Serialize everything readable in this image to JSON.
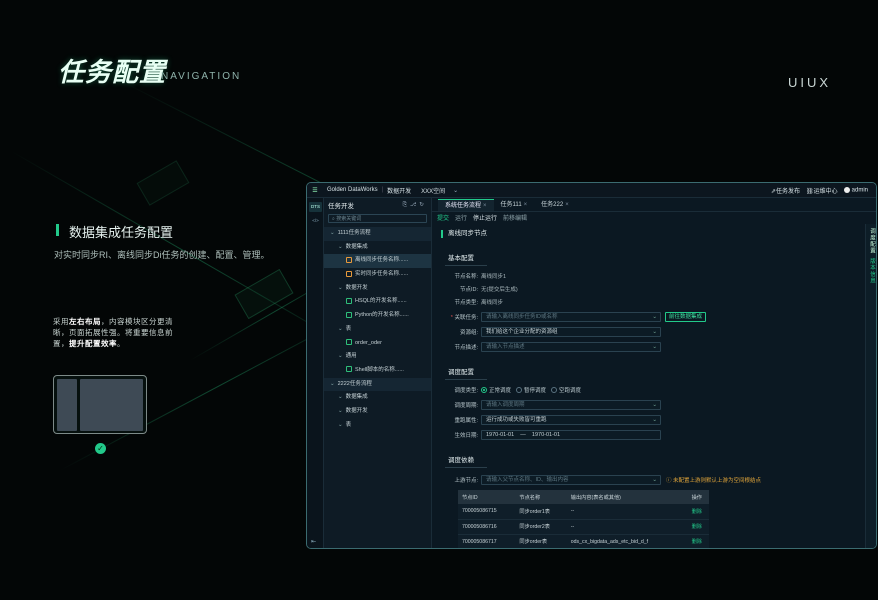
{
  "page": {
    "title": "任务配置",
    "nav_label": "NAVIGATION",
    "brand_tag": "UIUX",
    "section_title": "数据集成任务配置",
    "section_desc": "对实时同步RI、离线同步Di任务的创建、配置、管理。",
    "note_prefix": "采用",
    "note_bold1": "左右布局",
    "note_mid": "，内容模块区分更清晰，页面拓展性强。将重要信息前置，",
    "note_bold2": "提升配置效率",
    "note_suffix": "。",
    "accent": "#22c98a"
  },
  "app": {
    "topbar": {
      "menu_icon": "☰",
      "brand": "Golden DataWorks",
      "module": "数据开发",
      "space": "XXX空间",
      "right_items": [
        "任务发布",
        "运维中心"
      ],
      "user": "admin"
    },
    "rail": {
      "items": [
        "DTS",
        "</>"
      ]
    },
    "sidebar": {
      "title": "任务开发",
      "search_placeholder": "搜索关键词",
      "tree": [
        {
          "label": "1111任务流程",
          "level": 0,
          "type": "root"
        },
        {
          "label": "数据集成",
          "level": 1,
          "type": "folder"
        },
        {
          "label": "离线同步任务名称......",
          "level": 2,
          "type": "file-orange",
          "selected": true
        },
        {
          "label": "实时同步任务名称......",
          "level": 2,
          "type": "file-orange"
        },
        {
          "label": "数据开发",
          "level": 1,
          "type": "folder"
        },
        {
          "label": "HSQL的开发名称......",
          "level": 2,
          "type": "file-green"
        },
        {
          "label": "Python的开发名称......",
          "level": 2,
          "type": "file-green"
        },
        {
          "label": "表",
          "level": 1,
          "type": "folder"
        },
        {
          "label": "order_oder",
          "level": 2,
          "type": "file-green"
        },
        {
          "label": "通用",
          "level": 1,
          "type": "folder"
        },
        {
          "label": "Shell脚本的名称......",
          "level": 2,
          "type": "file-green"
        },
        {
          "label": "2222任务流程",
          "level": 0,
          "type": "root"
        },
        {
          "label": "数据集成",
          "level": 1,
          "type": "folder"
        },
        {
          "label": "数据开发",
          "level": 1,
          "type": "folder"
        },
        {
          "label": "表",
          "level": 1,
          "type": "folder"
        }
      ]
    },
    "tabs": [
      {
        "label": "系统任务流程",
        "active": true
      },
      {
        "label": "任务111",
        "active": false
      },
      {
        "label": "任务222",
        "active": false
      }
    ],
    "toolbar": [
      "提交",
      "运行",
      "停止运行",
      "前移编辑"
    ],
    "side_tabs": [
      "调度配置",
      "版本信息"
    ],
    "node_title": "离线同步节点",
    "basic": {
      "heading": "基本配置",
      "name_label": "节点名称:",
      "name_value": "离线同步1",
      "id_label": "节点ID:",
      "id_value": "无(提交后生成)",
      "type_label": "节点类型:",
      "type_value": "离线同步",
      "link_label": "关联任务:",
      "link_placeholder": "请输入离线同步任务ID或名称",
      "link_button": "前往数据集成",
      "group_label": "资源组:",
      "group_value": "我们给这个企业分配的资源组",
      "desc_label": "节点描述:",
      "desc_placeholder": "请输入节点描述"
    },
    "schedule": {
      "heading": "调度配置",
      "type_label": "调度类型:",
      "types": [
        "正常调度",
        "暂停调度",
        "空跑调度"
      ],
      "period_label": "调度周期:",
      "period_placeholder": "请输入调度周期",
      "rerun_label": "重跑属性:",
      "rerun_value": "运行成功或失败皆可重跑",
      "date_label": "生效日期:",
      "date_start": "1970-01-01",
      "date_sep": "—",
      "date_end": "1970-01-01"
    },
    "deps": {
      "heading": "调度依赖",
      "upstream_label": "上游节点:",
      "upstream_placeholder": "请输入父节点名称、ID、输出内容",
      "warning": "未配置上游则默认上游为空间根结点",
      "columns": [
        "节点ID",
        "节点名称",
        "输出内容(表名或其他)",
        "操作"
      ],
      "rows": [
        [
          "700005086715",
          "同步order1表",
          "--",
          "删除"
        ],
        [
          "700005086716",
          "同步order2表",
          "--",
          "删除"
        ],
        [
          "700005086717",
          "同步order表",
          "ods_cx_bigdata_ads_etc_bid_d_f",
          "删除"
        ]
      ]
    }
  }
}
